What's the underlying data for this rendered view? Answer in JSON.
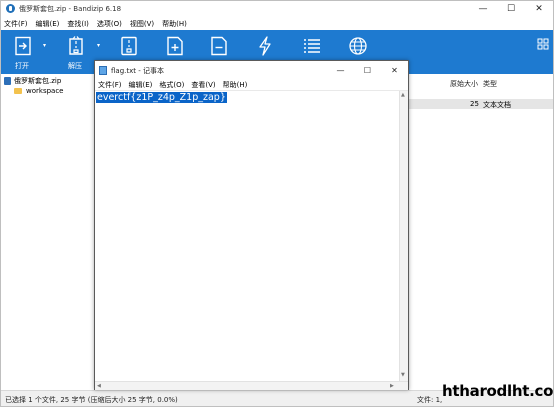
{
  "window": {
    "title": "俄罗斯套包.zip - Bandizip 6.18",
    "minimize": "—",
    "maximize": "☐",
    "close": "✕"
  },
  "menu": [
    "文件(F)",
    "编辑(E)",
    "查找(I)",
    "选项(O)",
    "视图(V)",
    "帮助(H)"
  ],
  "toolbar": {
    "items": [
      {
        "label": "打开",
        "icon": "open-archive-icon"
      },
      {
        "label": "解压",
        "icon": "extract-icon"
      },
      {
        "label": "",
        "icon": "new-archive-icon"
      },
      {
        "label": "",
        "icon": "add-files-icon"
      },
      {
        "label": "",
        "icon": "delete-icon"
      },
      {
        "label": "",
        "icon": "test-archive-icon"
      },
      {
        "label": "",
        "icon": "view-list-icon"
      },
      {
        "label": "",
        "icon": "globe-icon"
      }
    ],
    "caret": "▾"
  },
  "tree": [
    {
      "name": "俄罗斯套包.zip",
      "icon": "zip-icon"
    },
    {
      "name": "workspace",
      "icon": "folder-icon"
    }
  ],
  "columns": {
    "original_size": "原始大小",
    "type": "类型"
  },
  "file_row": {
    "size": "25",
    "type": "文本文档"
  },
  "status": {
    "left": "已选择 1 个文件, 25 字节 (压缩后大小 25 字节, 0.0%)",
    "right": "文件: 1,"
  },
  "watermark": "htharodlht.com",
  "notepad": {
    "title": "flag.txt - 记事本",
    "menu": [
      "文件(F)",
      "编辑(E)",
      "格式(O)",
      "查看(V)",
      "帮助(H)"
    ],
    "content": "everctf{z1P_z4p_Z1p_zap}",
    "minimize": "—",
    "maximize": "☐",
    "close": "✕"
  },
  "colors": {
    "toolbar": "#1e7ad0",
    "selection": "#0a64c8",
    "folder": "#f3c24d"
  }
}
